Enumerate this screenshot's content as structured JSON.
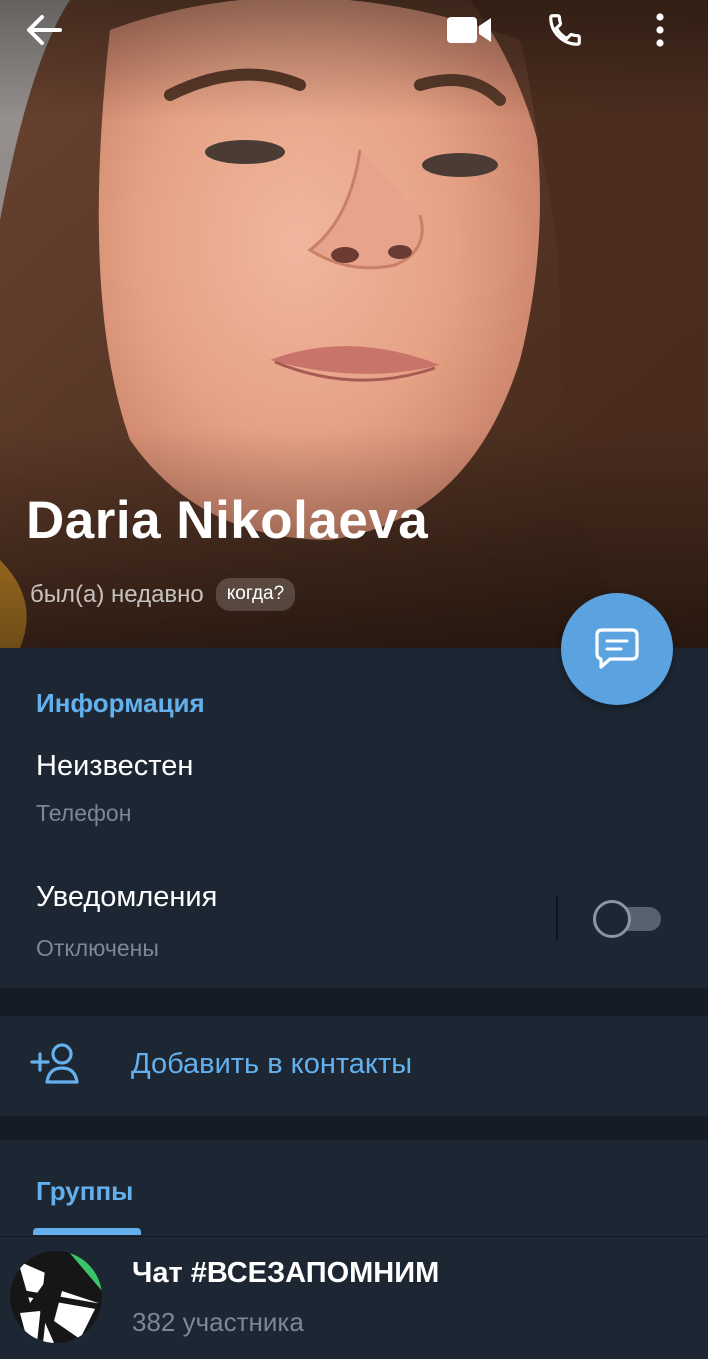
{
  "profile": {
    "name": "Daria Nikolaeva",
    "status": "был(а) недавно",
    "when_badge": "когда?"
  },
  "topbar": {
    "back_icon": "arrow-left-icon",
    "video_icon": "video-camera-icon",
    "call_icon": "phone-icon",
    "menu_icon": "more-vertical-icon"
  },
  "fab": {
    "icon": "message-icon"
  },
  "info": {
    "title": "Информация",
    "phone_value": "Неизвестен",
    "phone_label": "Телефон",
    "notifications_title": "Уведомления",
    "notifications_state": "Отключены",
    "notifications_enabled": false
  },
  "add_contact": {
    "icon": "add-user-icon",
    "label": "Добавить в контакты"
  },
  "groups": {
    "title": "Группы",
    "items": [
      {
        "name": "Чат #ВСЕЗАПОМНИМ",
        "members": "382 участника"
      }
    ]
  },
  "colors": {
    "accent": "#64b0ec",
    "fab": "#5aa3e0",
    "card_bg": "#1d2733",
    "page_bg": "#151c25",
    "secondary_text": "#7b8794"
  }
}
